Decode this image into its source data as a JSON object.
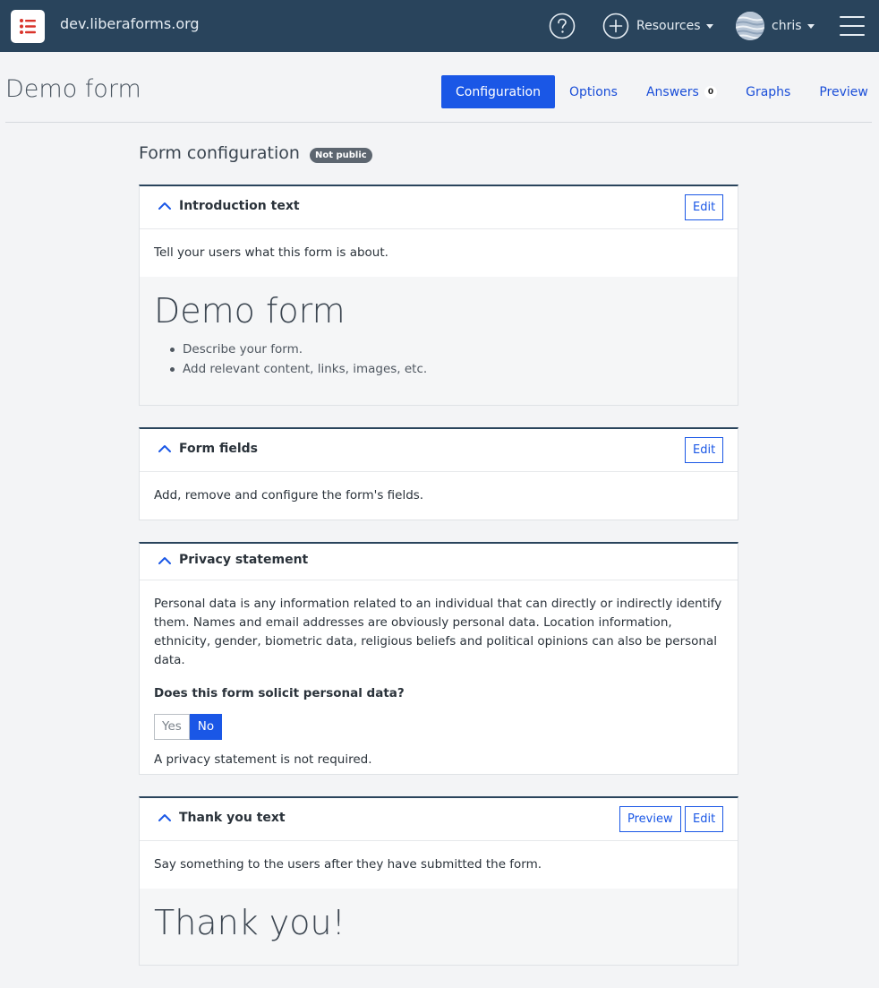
{
  "navbar": {
    "site_name": "dev.liberaforms.org",
    "resources_label": "Resources",
    "user_label": "chris"
  },
  "page": {
    "title": "Demo form",
    "tabs": [
      {
        "label": "Configuration",
        "active": true
      },
      {
        "label": "Options"
      },
      {
        "label": "Answers",
        "count": "0"
      },
      {
        "label": "Graphs"
      },
      {
        "label": "Preview"
      }
    ]
  },
  "config": {
    "title": "Form configuration",
    "badge": "Not public"
  },
  "intro": {
    "title": "Introduction text",
    "edit": "Edit",
    "description": "Tell your users what this form is about.",
    "preview_heading": "Demo form",
    "preview_items": [
      "Describe your form.",
      "Add relevant content, links, images, etc."
    ]
  },
  "fields": {
    "title": "Form fields",
    "edit": "Edit",
    "description": "Add, remove and configure the form's fields."
  },
  "privacy": {
    "title": "Privacy statement",
    "description": "Personal data is any information related to an individual that can directly or indirectly identify them. Names and email addresses are obviously personal data. Location information, ethnicity, gender, biometric data, religious beliefs and political opinions can also be personal data.",
    "question": "Does this form solicit personal data?",
    "yes": "Yes",
    "no": "No",
    "selected": "No",
    "note": "A privacy statement is not required."
  },
  "thanks": {
    "title": "Thank you text",
    "preview": "Preview",
    "edit": "Edit",
    "description": "Say something to the users after they have submitted the form.",
    "preview_heading": "Thank you!"
  },
  "colors": {
    "navbar": "#29445c",
    "accent": "#1a57e6",
    "badge": "#5d6670"
  }
}
